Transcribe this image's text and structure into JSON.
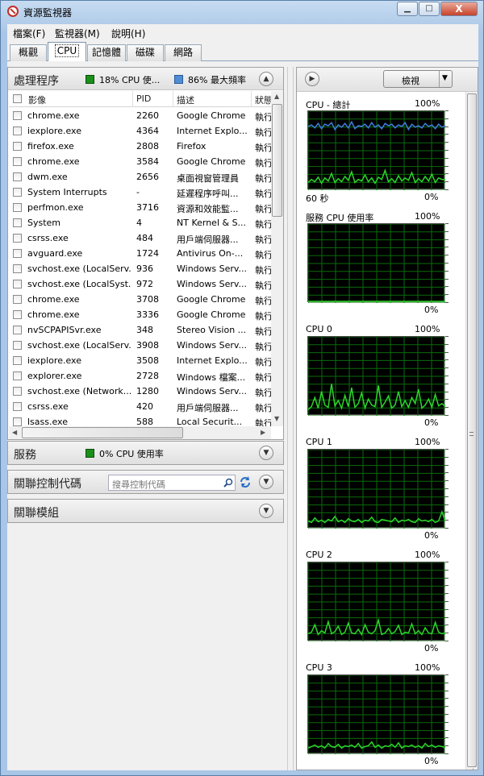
{
  "window": {
    "title": "資源監視器",
    "controls": {
      "minimize": "▁",
      "maximize": "□",
      "close": "X"
    }
  },
  "menu": [
    "檔案(F)",
    "監視器(M)",
    "說明(H)"
  ],
  "tabs": [
    "概觀",
    "CPU",
    "記憶體",
    "磁碟",
    "網路"
  ],
  "active_tab": 1,
  "process_panel": {
    "title": "處理程序",
    "cpu_stat": "18% CPU 使...",
    "freq_stat": "86% 最大頻率",
    "colors": {
      "cpu": "#1a8f1a",
      "freq": "#4f8ed6"
    },
    "columns": [
      "影像",
      "PID",
      "描述",
      "狀態"
    ],
    "rows": [
      [
        "chrome.exe",
        "2260",
        "Google Chrome",
        "執行"
      ],
      [
        "iexplore.exe",
        "4364",
        "Internet Explo...",
        "執行"
      ],
      [
        "firefox.exe",
        "2808",
        "Firefox",
        "執行"
      ],
      [
        "chrome.exe",
        "3584",
        "Google Chrome",
        "執行"
      ],
      [
        "dwm.exe",
        "2656",
        "桌面視窗管理員",
        "執行"
      ],
      [
        "System Interrupts",
        "-",
        "延遲程序呼叫...",
        "執行"
      ],
      [
        "perfmon.exe",
        "3716",
        "資源和效能監...",
        "執行"
      ],
      [
        "System",
        "4",
        "NT Kernel & S...",
        "執行"
      ],
      [
        "csrss.exe",
        "484",
        "用戶端伺服器...",
        "執行"
      ],
      [
        "avguard.exe",
        "1724",
        "Antivirus On-...",
        "執行"
      ],
      [
        "svchost.exe (LocalServ...",
        "936",
        "Windows Serv...",
        "執行"
      ],
      [
        "svchost.exe (LocalSyst...",
        "972",
        "Windows Serv...",
        "執行"
      ],
      [
        "chrome.exe",
        "3708",
        "Google Chrome",
        "執行"
      ],
      [
        "chrome.exe",
        "3336",
        "Google Chrome",
        "執行"
      ],
      [
        "nvSCPAPISvr.exe",
        "348",
        "Stereo Vision ...",
        "執行"
      ],
      [
        "svchost.exe (LocalServ...",
        "3908",
        "Windows Serv...",
        "執行"
      ],
      [
        "iexplore.exe",
        "3508",
        "Internet Explo...",
        "執行"
      ],
      [
        "explorer.exe",
        "2728",
        "Windows 檔案...",
        "執行"
      ],
      [
        "svchost.exe (Network...",
        "1280",
        "Windows Serv...",
        "執行"
      ],
      [
        "csrss.exe",
        "420",
        "用戶端伺服器...",
        "執行"
      ],
      [
        "lsass.exe",
        "588",
        "Local Securit...",
        "執行"
      ]
    ]
  },
  "services_panel": {
    "title": "服務",
    "stat": "0% CPU 使用率"
  },
  "handles_panel": {
    "title": "關聯控制代碼",
    "search_placeholder": "搜尋控制代碼"
  },
  "modules_panel": {
    "title": "關聯模組"
  },
  "right_panel": {
    "view_button": "檢視",
    "graphs": [
      {
        "title": "CPU - 總計",
        "max": "100%",
        "min": "0%",
        "time": "60 秒",
        "green": [
          8,
          12,
          9,
          15,
          7,
          14,
          10,
          20,
          8,
          13,
          9,
          16,
          11,
          22,
          8,
          12,
          10,
          18,
          9,
          14,
          7,
          15,
          12,
          24,
          9,
          13,
          8,
          17,
          10,
          14,
          11,
          21,
          8,
          13,
          9,
          16,
          10,
          19,
          8,
          14,
          12,
          12
        ],
        "blue": [
          82,
          84,
          80,
          86,
          79,
          85,
          83,
          87,
          78,
          84,
          81,
          86,
          80,
          88,
          79,
          83,
          82,
          85,
          80,
          87,
          81,
          84,
          79,
          86,
          83,
          85,
          80,
          84,
          82,
          87,
          78,
          85,
          81,
          83,
          80,
          86,
          82,
          84,
          79,
          85,
          81,
          83
        ]
      },
      {
        "title": "服務 CPU 使用率",
        "max": "100%",
        "min": "0%",
        "green": [
          0,
          0,
          0,
          0,
          0,
          0,
          0,
          0,
          0,
          0,
          0,
          0,
          0,
          0,
          0,
          0,
          0,
          0,
          0,
          0,
          0,
          0,
          0,
          0,
          0,
          0,
          0,
          0,
          0,
          0,
          0,
          0,
          0,
          0,
          0,
          0,
          0,
          0,
          0,
          0,
          0,
          0
        ]
      },
      {
        "title": "CPU 0",
        "max": "100%",
        "min": "0%",
        "green": [
          6,
          10,
          22,
          8,
          30,
          12,
          9,
          40,
          11,
          18,
          8,
          25,
          10,
          35,
          9,
          14,
          28,
          8,
          20,
          12,
          10,
          38,
          9,
          16,
          24,
          8,
          12,
          30,
          10,
          18,
          9,
          22,
          14,
          33,
          8,
          12,
          20,
          9,
          26,
          11,
          14,
          10
        ]
      },
      {
        "title": "CPU 1",
        "max": "100%",
        "min": "0%",
        "green": [
          8,
          6,
          12,
          7,
          9,
          6,
          10,
          8,
          14,
          7,
          9,
          6,
          11,
          8,
          7,
          10,
          6,
          9,
          8,
          13,
          7,
          6,
          10,
          9,
          8,
          7,
          12,
          6,
          9,
          8,
          10,
          7,
          6,
          11,
          8,
          9,
          7,
          10,
          6,
          8,
          20,
          8
        ]
      },
      {
        "title": "CPU 2",
        "max": "100%",
        "min": "0%",
        "green": [
          8,
          10,
          20,
          7,
          12,
          9,
          24,
          8,
          11,
          18,
          7,
          10,
          22,
          9,
          8,
          14,
          7,
          20,
          10,
          8,
          12,
          26,
          7,
          9,
          15,
          8,
          11,
          19,
          7,
          10,
          9,
          21,
          8,
          12,
          7,
          16,
          9,
          8,
          23,
          10,
          8,
          9
        ]
      },
      {
        "title": "CPU 3",
        "max": "100%",
        "min": "0%",
        "green": [
          6,
          8,
          10,
          7,
          9,
          6,
          12,
          8,
          7,
          11,
          6,
          9,
          8,
          10,
          7,
          12,
          6,
          8,
          9,
          14,
          7,
          10,
          6,
          9,
          8,
          11,
          7,
          13,
          6,
          9,
          8,
          10,
          7,
          9,
          6,
          12,
          8,
          10,
          7,
          9,
          8,
          7
        ]
      }
    ]
  }
}
